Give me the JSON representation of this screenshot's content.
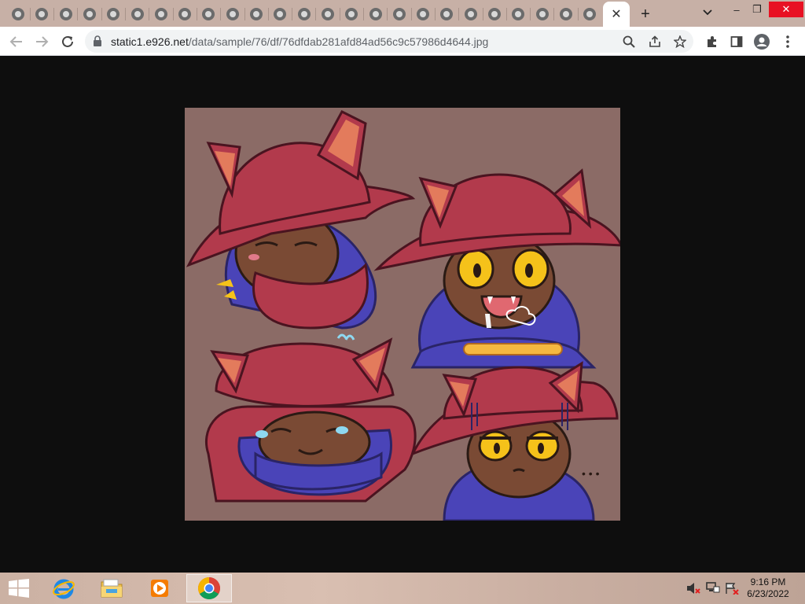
{
  "browser": {
    "inactive_tab_count": 25,
    "active_tab_close": "✕",
    "new_tab": "+",
    "window_controls": {
      "tab_search": "⌄",
      "minimize": "–",
      "restore": "❐",
      "close": "✕"
    },
    "url_host": "static1.e926.net",
    "url_path": "/data/sample/76/df/76dfdab281afd84ad56c9c57986d4644.jpg"
  },
  "colors": {
    "tabstrip": "#c7b0a6",
    "art_background": "#8b6b66",
    "hat": "#b23a4c",
    "hair": "#4a44b8",
    "skin": "#7a4a34",
    "eyes": "#f5c21a"
  },
  "art": {
    "dots": "• • •"
  },
  "taskbar": {
    "apps": [
      "start-icon",
      "internet-explorer-icon",
      "file-explorer-icon",
      "media-player-icon",
      "chrome-icon"
    ],
    "time": "9:16 PM",
    "date": "6/23/2022"
  }
}
